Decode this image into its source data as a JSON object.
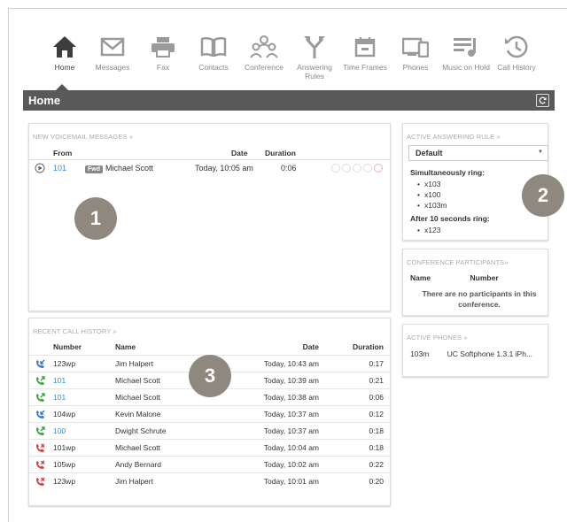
{
  "nav": {
    "items": [
      {
        "label": "Home",
        "icon": "home-icon"
      },
      {
        "label": "Messages",
        "icon": "envelope-icon"
      },
      {
        "label": "Fax",
        "icon": "printer-icon"
      },
      {
        "label": "Contacts",
        "icon": "book-icon"
      },
      {
        "label": "Conference",
        "icon": "people-icon"
      },
      {
        "label": "Answering Rules",
        "icon": "branch-arrows-icon"
      },
      {
        "label": "Time Frames",
        "icon": "calendar-icon"
      },
      {
        "label": "Phones",
        "icon": "devices-icon"
      },
      {
        "label": "Music on Hold",
        "icon": "music-list-icon"
      },
      {
        "label": "Call History",
        "icon": "history-icon"
      }
    ]
  },
  "header": {
    "title": "Home"
  },
  "voicemail": {
    "title": "NEW VOICEMAIL MESSAGES »",
    "columns": {
      "from": "From",
      "date": "Date",
      "duration": "Duration"
    },
    "rows": [
      {
        "from": "101",
        "badge": "Fwd",
        "name": "Michael Scott",
        "date": "Today, 10:05 am",
        "duration": "0:06"
      }
    ]
  },
  "history": {
    "title": "RECENT CALL HISTORY »",
    "columns": {
      "number": "Number",
      "name": "Name",
      "date": "Date",
      "duration": "Duration"
    },
    "rows": [
      {
        "type": "inbound",
        "number": "123wp",
        "name": "Jim Halpert",
        "date": "Today, 10:43 am",
        "duration": "0:17",
        "link": false
      },
      {
        "type": "outbound",
        "number": "101",
        "name": "Michael Scott",
        "date": "Today, 10:39 am",
        "duration": "0:21",
        "link": true
      },
      {
        "type": "outbound",
        "number": "101",
        "name": "Michael Scott",
        "date": "Today, 10:38 am",
        "duration": "0:06",
        "link": true
      },
      {
        "type": "inbound",
        "number": "104wp",
        "name": "Kevin Malone",
        "date": "Today, 10:37 am",
        "duration": "0:12",
        "link": false
      },
      {
        "type": "outbound",
        "number": "100",
        "name": "Dwight Schrute",
        "date": "Today, 10:37 am",
        "duration": "0:18",
        "link": true
      },
      {
        "type": "missed",
        "number": "101wp",
        "name": "Michael Scott",
        "date": "Today, 10:04 am",
        "duration": "0:18",
        "link": false
      },
      {
        "type": "missed",
        "number": "105wp",
        "name": "Andy Bernard",
        "date": "Today, 10:02 am",
        "duration": "0:22",
        "link": false
      },
      {
        "type": "missed",
        "number": "123wp",
        "name": "Jim Halpert",
        "date": "Today, 10:01 am",
        "duration": "0:20",
        "link": false
      }
    ]
  },
  "answering_rule": {
    "title": "ACTIVE ANSWERING RULE »",
    "selected": "Default",
    "sim_label": "Simultaneously ring:",
    "sim": [
      "x103",
      "x100",
      "x103m"
    ],
    "after_label": "After 10 seconds ring:",
    "after": [
      "x123"
    ]
  },
  "conference": {
    "title": "CONFERENCE PARTICIPANTS»",
    "col_name": "Name",
    "col_number": "Number",
    "empty": "There are no participants in this conference."
  },
  "phones": {
    "title": "ACTIVE PHONES »",
    "rows": [
      {
        "id": "103m",
        "device": "UC Softphone 1.3.1 iPh..."
      }
    ]
  },
  "callouts": [
    "1",
    "2",
    "3"
  ],
  "colors": {
    "inbound": "#3a78d0",
    "outbound": "#3aa835",
    "missed": "#e03b3b",
    "link": "#3a8ad0",
    "bar": "#595959"
  }
}
